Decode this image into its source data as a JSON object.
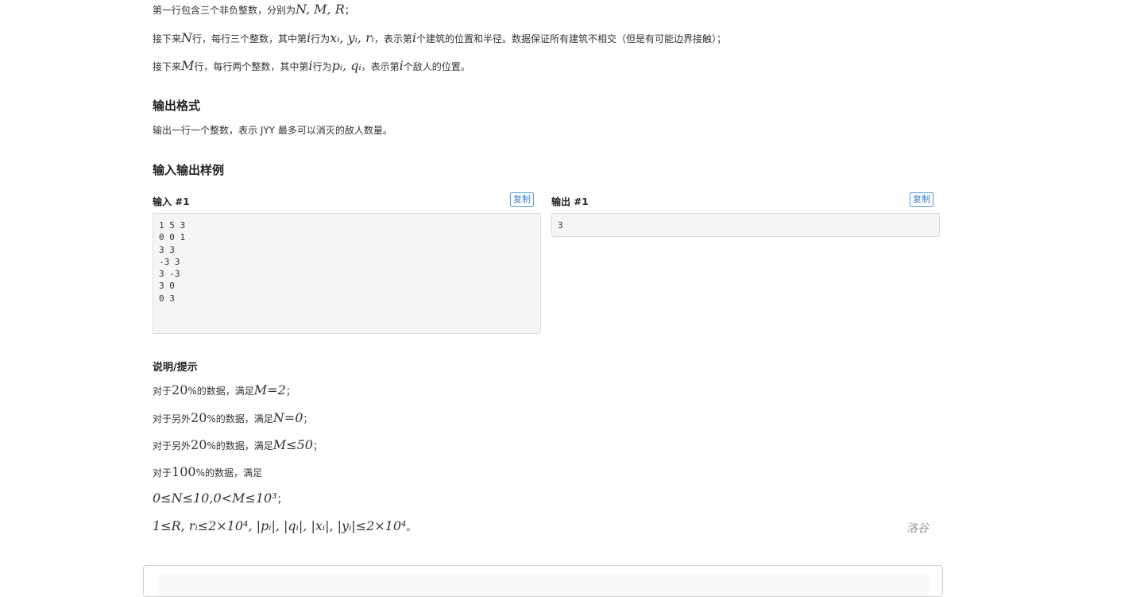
{
  "input_format": {
    "line1_pre": "第一行包含三个非负整数，分别为",
    "line1_math": "N, M, R",
    "line1_post": "；",
    "line2_pre": "接下来",
    "line2_math1": "N",
    "line2_mid": "行，每行三个整数，其中第",
    "line2_math2": "i",
    "line2_mid2": "行为",
    "line2_math3": "xᵢ, yᵢ, rᵢ",
    "line2_mid3": "，表示第",
    "line2_math4": "i",
    "line2_post": "个建筑的位置和半径。数据保证所有建筑不相交（但是有可能边界接触）；",
    "line3_pre": "接下来",
    "line3_math1": "M",
    "line3_mid": "行，每行两个整数，其中第",
    "line3_math2": "i",
    "line3_mid2": "行为",
    "line3_math3": "pᵢ, qᵢ",
    "line3_mid3": "，表示第",
    "line3_math4": "i",
    "line3_post": "个敌人的位置。"
  },
  "output_format": {
    "heading": "输出格式",
    "text": "输出一行一个整数，表示 JYY 最多可以消灭的敌人数量。"
  },
  "samples": {
    "heading": "输入输出样例",
    "input_label": "输入 #1",
    "output_label": "输出 #1",
    "copy_label": "复制",
    "input_text": "1 5 3\n0 0 1\n3 3\n-3 3\n3 -3\n3 0\n0 3",
    "output_text": "3"
  },
  "hints": {
    "heading": "说明/提示",
    "l1_pre": "对于",
    "l1_math": "20",
    "l1_mid": "%的数据，满足",
    "l1_math2": "M=2",
    "l1_post": "；",
    "l2_pre": "对于另外",
    "l2_math": "20",
    "l2_mid": "%的数据，满足",
    "l2_math2": "N=0",
    "l2_post": "；",
    "l3_pre": "对于另外",
    "l3_math": "20",
    "l3_mid": "%的数据，满足",
    "l3_math2": "M≤50",
    "l3_post": "；",
    "l4_pre": "对于",
    "l4_math": "100",
    "l4_post": "%的数据，满足",
    "l5_math": "0≤N≤10,0<M≤10³",
    "l5_post": "；",
    "l6_math": "1≤R, rᵢ≤2×10⁴, |pᵢ|, |qᵢ|, |xᵢ|, |yᵢ|≤2×10⁴",
    "l6_post": "。"
  },
  "source_label": "洛谷"
}
